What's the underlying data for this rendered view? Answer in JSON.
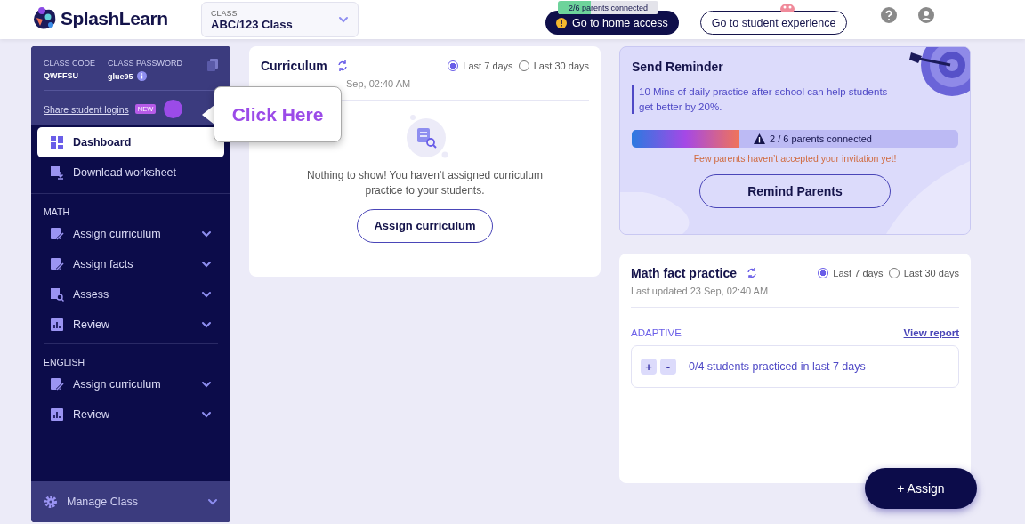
{
  "header": {
    "logo": "SplashLearn",
    "class_select": {
      "label": "CLASS",
      "value": "ABC/123 Class"
    },
    "home_access": {
      "badge": "2/6 parents connected",
      "level": 0.33,
      "label": "Go to home access"
    },
    "student_button": "Go to student experience"
  },
  "sidebar": {
    "class_code": {
      "label": "CLASS CODE",
      "value": "QWFFSU"
    },
    "class_password": {
      "label": "CLASS PASSWORD",
      "value": "glue95"
    },
    "share_link": "Share student logins",
    "new_badge": "NEW",
    "top_items": [
      {
        "kind": "dashboard",
        "label": "Dashboard",
        "selected": true
      },
      {
        "kind": "worksheet",
        "label": "Download worksheet",
        "selected": false
      }
    ],
    "sections": [
      {
        "title": "MATH",
        "items": [
          {
            "kind": "assign",
            "label": "Assign curriculum",
            "selected": false,
            "expanded": false
          },
          {
            "kind": "assign",
            "label": "Assign facts",
            "selected": false,
            "expanded": false
          },
          {
            "kind": "assess",
            "label": "Assess",
            "selected": false,
            "expanded": false
          },
          {
            "kind": "review",
            "label": "Review",
            "selected": false,
            "expanded": false
          }
        ]
      },
      {
        "title": "ENGLISH",
        "items": [
          {
            "kind": "assign",
            "label": "Assign curriculum",
            "selected": false,
            "expanded": false
          },
          {
            "kind": "review",
            "label": "Review",
            "selected": false,
            "expanded": false
          }
        ]
      }
    ],
    "manage": {
      "label": "Manage Class",
      "expanded": false
    }
  },
  "tooltip": "Click Here",
  "curriculum": {
    "title": "Curriculum",
    "ranges": [
      {
        "label": "Last 7 days",
        "selected": true
      },
      {
        "label": "Last 30 days",
        "selected": false
      }
    ],
    "updated": "Sep, 02:40 AM",
    "empty_text": "Nothing to show! You haven’t assigned curriculum practice to your students.",
    "button": "Assign curriculum"
  },
  "reminder": {
    "title": "Send Reminder",
    "tip": "10 Mins of daily practice after school can help students get better by 20%.",
    "level": 0.33,
    "progress_label": "2 / 6 parents connected",
    "warning": "Few parents haven’t accepted your invitation yet!",
    "button": "Remind Parents"
  },
  "math_facts": {
    "title": "Math fact practice",
    "ranges": [
      {
        "label": "Last 7 days",
        "selected": true
      },
      {
        "label": "Last 30 days",
        "selected": false
      }
    ],
    "updated": "Last updated 23 Sep, 02:40 AM",
    "section": "ADAPTIVE",
    "link": "View report",
    "expand_button": "+",
    "collapse_button": "-",
    "summary": "0/4 students practiced in last 7 days"
  },
  "assign_button": "+ Assign"
}
